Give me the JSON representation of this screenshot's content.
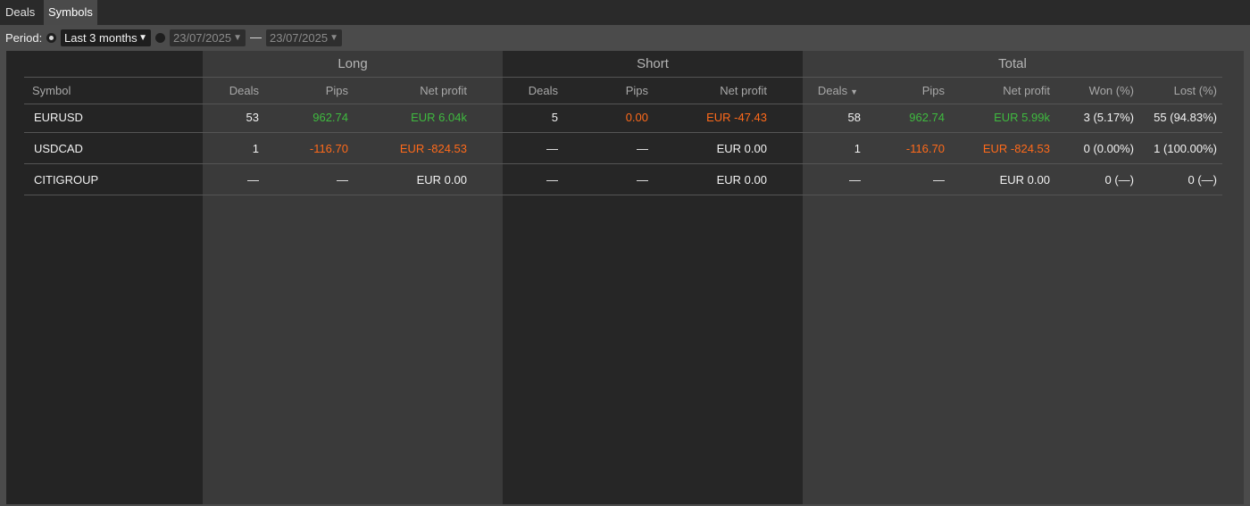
{
  "tabs": [
    {
      "label": "Deals",
      "active": false
    },
    {
      "label": "Symbols",
      "active": true
    }
  ],
  "filter": {
    "period_label": "Period:",
    "range_value": "Last 3 months",
    "date_from": "23/07/2025",
    "date_to": "23/07/2025",
    "separator": "—"
  },
  "groups": {
    "long": "Long",
    "short": "Short",
    "total": "Total"
  },
  "columns": {
    "symbol": "Symbol",
    "deals": "Deals",
    "pips": "Pips",
    "net_profit": "Net profit",
    "won": "Won (%)",
    "lost": "Lost (%)"
  },
  "sort": {
    "column": "total_deals",
    "direction": "desc",
    "icon": "sort-desc-icon"
  },
  "colors": {
    "positive": "#3fba3f",
    "negative": "#ff6a1a",
    "neutral": "#f2f2f2"
  },
  "rows": [
    {
      "symbol": "EURUSD",
      "long": {
        "deals": "53",
        "pips": "962.74",
        "net_profit": "EUR 6.04k"
      },
      "short": {
        "deals": "5",
        "pips": "0.00",
        "net_profit": "EUR -47.43"
      },
      "total": {
        "deals": "58",
        "pips": "962.74",
        "net_profit": "EUR 5.99k",
        "won": "3 (5.17%)",
        "lost": "55 (94.83%)"
      }
    },
    {
      "symbol": "USDCAD",
      "long": {
        "deals": "1",
        "pips": "-116.70",
        "net_profit": "EUR -824.53"
      },
      "short": {
        "deals": "—",
        "pips": "—",
        "net_profit": "EUR 0.00"
      },
      "total": {
        "deals": "1",
        "pips": "-116.70",
        "net_profit": "EUR -824.53",
        "won": "0 (0.00%)",
        "lost": "1 (100.00%)"
      }
    },
    {
      "symbol": "CITIGROUP",
      "long": {
        "deals": "—",
        "pips": "—",
        "net_profit": "EUR 0.00"
      },
      "short": {
        "deals": "—",
        "pips": "—",
        "net_profit": "EUR 0.00"
      },
      "total": {
        "deals": "—",
        "pips": "—",
        "net_profit": "EUR 0.00",
        "won": "0 (—)",
        "lost": "0 (—)"
      }
    }
  ]
}
